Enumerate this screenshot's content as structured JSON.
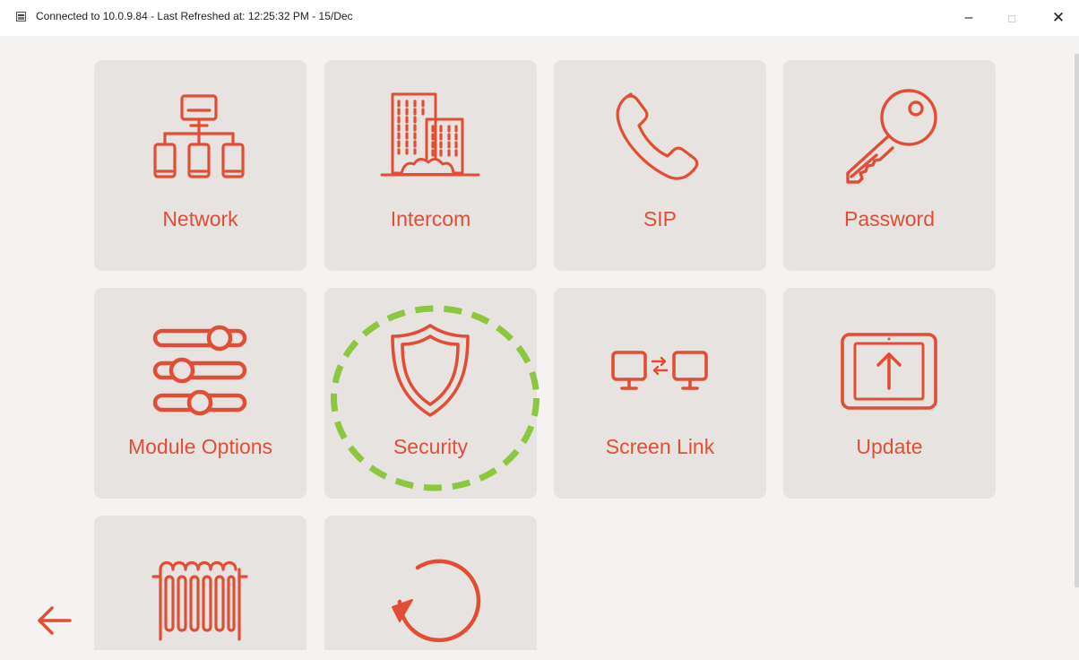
{
  "window": {
    "title": "Connected to 10.0.9.84 - Last Refreshed at: 12:25:32 PM - 15/Dec",
    "controls": {
      "minimize": "–",
      "maximize": "□",
      "close": "✕"
    }
  },
  "colors": {
    "accent": "#e24e35",
    "tile": "#e6e3e0",
    "background": "#f4f3f2",
    "highlight": "#8dc63f"
  },
  "tiles": [
    {
      "label": "Network",
      "icon": "network-icon"
    },
    {
      "label": "Intercom",
      "icon": "building-icon"
    },
    {
      "label": "SIP",
      "icon": "phone-icon"
    },
    {
      "label": "Password",
      "icon": "key-icon"
    },
    {
      "label": "Module Options",
      "icon": "sliders-icon"
    },
    {
      "label": "Security",
      "icon": "shield-icon"
    },
    {
      "label": "Screen Link",
      "icon": "screen-link-icon"
    },
    {
      "label": "Update",
      "icon": "update-icon"
    },
    {
      "label": "",
      "icon": "radiator-icon"
    },
    {
      "label": "",
      "icon": "reset-icon"
    }
  ],
  "navigation": {
    "back_icon": "back-arrow-icon"
  },
  "highlight": {
    "target": "Security"
  }
}
